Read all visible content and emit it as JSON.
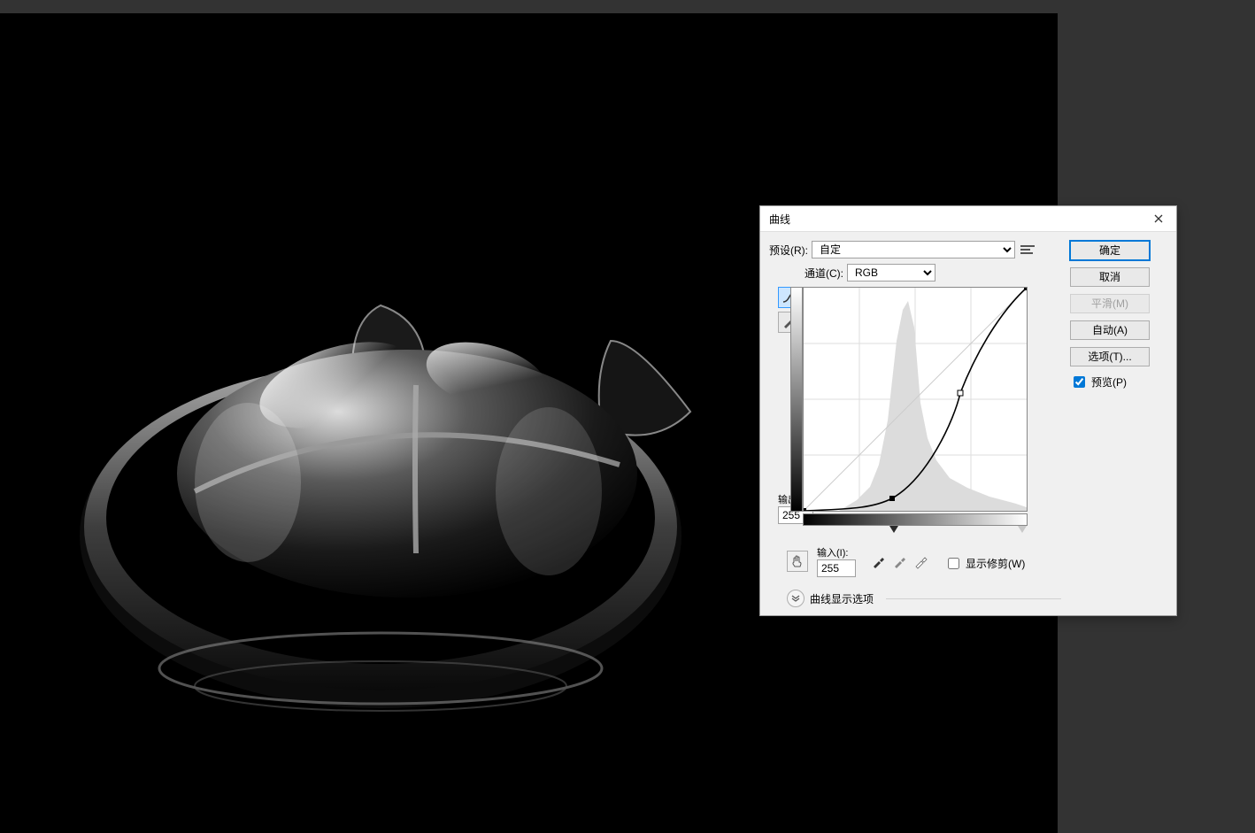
{
  "dialog": {
    "title": "曲线",
    "preset_label": "预设(R):",
    "preset_value": "自定",
    "channel_label": "通道(C):",
    "channel_value": "RGB",
    "output_label": "输出(O):",
    "output_value": "255",
    "input_label": "输入(I):",
    "input_value": "255",
    "show_clipping_label": "显示修剪(W)",
    "show_clipping_checked": false,
    "curve_options_label": "曲线显示选项",
    "buttons": {
      "ok": "确定",
      "cancel": "取消",
      "smooth": "平滑(M)",
      "auto": "自动(A)",
      "options": "选项(T)..."
    },
    "preview_label": "预览(P)",
    "preview_checked": true
  },
  "chart_data": {
    "type": "line",
    "title": "Curves",
    "xlabel": "Input",
    "ylabel": "Output",
    "xlim": [
      0,
      255
    ],
    "ylim": [
      0,
      255
    ],
    "series": [
      {
        "name": "RGB curve",
        "points": [
          {
            "x": 0,
            "y": 0
          },
          {
            "x": 100,
            "y": 14
          },
          {
            "x": 179,
            "y": 135
          },
          {
            "x": 255,
            "y": 255
          }
        ]
      }
    ],
    "histogram_peak_x": 115,
    "black_point_input": 100,
    "white_point_input": 255
  }
}
